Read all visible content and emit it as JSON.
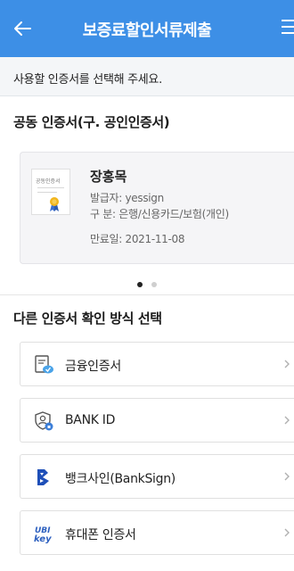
{
  "header": {
    "title": "보증료할인서류제출",
    "back_icon": "arrow-left-icon",
    "menu_icon": "menu-icon"
  },
  "subtitle": "사용할 인증서를 선택해 주세요.",
  "joint_cert": {
    "section_title": "공동 인증서(구. 공인인증서)",
    "card": {
      "thumb_label": "공동인증서",
      "name": "장홍목",
      "issuer": "발급자: yessign",
      "category": "구   분: 은행/신용카드/보험(개인)",
      "expiry": "만료일: 2021-11-08"
    },
    "pager": {
      "current": 1,
      "total": 2
    }
  },
  "other_methods": {
    "section_title": "다른 인증서 확인 방식 선택",
    "options": [
      {
        "label": "금융인증서",
        "icon": "financial-cert-icon"
      },
      {
        "label": "BANK ID",
        "icon": "bank-id-icon"
      },
      {
        "label": "뱅크사인(BankSign)",
        "icon": "banksign-icon"
      },
      {
        "label": "휴대폰 인증서",
        "icon": "ubikey-icon"
      }
    ]
  },
  "colors": {
    "header_bg": "#3d8fe6",
    "banksign_blue": "#1e4fb8",
    "ubikey_blue": "#2c5fbf"
  }
}
